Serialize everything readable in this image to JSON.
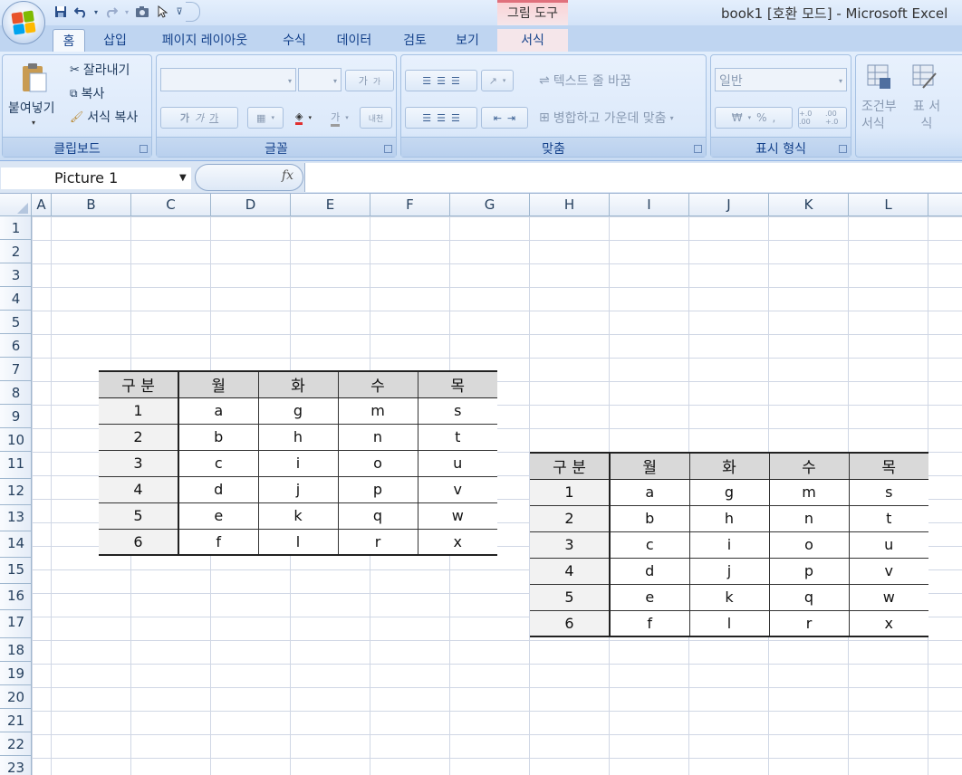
{
  "window": {
    "title": "book1  [호환 모드] - Microsoft Excel",
    "context_tab": "그림 도구"
  },
  "qat": {
    "icons": [
      "save-icon",
      "undo-icon",
      "redo-icon",
      "camera-icon",
      "pointer-icon",
      "customize-icon"
    ]
  },
  "tabs": [
    "홈",
    "삽입",
    "페이지 레이아웃",
    "수식",
    "데이터",
    "검토",
    "보기",
    "서식"
  ],
  "ribbon": {
    "clipboard": {
      "paste": "붙여넣기",
      "cut": "잘라내기",
      "copy": "복사",
      "format_painter": "서식 복사",
      "label": "클립보드"
    },
    "font": {
      "label": "글꼴",
      "grow": "가",
      "shrink": "가",
      "bold": "가",
      "italic": "가",
      "underline": "가",
      "font_color": "가",
      "phonetic": "내천"
    },
    "alignment": {
      "wrap": "텍스트 줄 바꿈",
      "merge": "병합하고 가운데 맞춤",
      "label": "맞춤"
    },
    "number": {
      "format": "일반",
      "currency": "₩",
      "percent": "%",
      "comma": ",",
      "inc_dec": "+.0 .00",
      "dec_dec": ".00 +.0",
      "label": "표시 형식"
    },
    "styles": {
      "conditional": "조건부 서식",
      "table": "표 서식"
    }
  },
  "formula_bar": {
    "name_box": "Picture 1",
    "fx": "fx",
    "value": ""
  },
  "columns": [
    "A",
    "B",
    "C",
    "D",
    "E",
    "F",
    "G",
    "H",
    "I",
    "J",
    "K",
    "L"
  ],
  "rows": [
    "1",
    "2",
    "3",
    "4",
    "5",
    "6",
    "7",
    "8",
    "9",
    "10",
    "11",
    "12",
    "13",
    "14",
    "15",
    "16",
    "17",
    "18",
    "19",
    "20",
    "21",
    "22",
    "23"
  ],
  "picture_table_1": {
    "headers": [
      "구 분",
      "월",
      "화",
      "수",
      "목"
    ],
    "rows": [
      [
        "1",
        "a",
        "g",
        "m",
        "s"
      ],
      [
        "2",
        "b",
        "h",
        "n",
        "t"
      ],
      [
        "3",
        "c",
        "i",
        "o",
        "u"
      ],
      [
        "4",
        "d",
        "j",
        "p",
        "v"
      ],
      [
        "5",
        "e",
        "k",
        "q",
        "w"
      ],
      [
        "6",
        "f",
        "l",
        "r",
        "x"
      ]
    ]
  },
  "picture_table_2": {
    "headers": [
      "구 분",
      "월",
      "화",
      "수",
      "목"
    ],
    "rows": [
      [
        "1",
        "a",
        "g",
        "m",
        "s"
      ],
      [
        "2",
        "b",
        "h",
        "n",
        "t"
      ],
      [
        "3",
        "c",
        "i",
        "o",
        "u"
      ],
      [
        "4",
        "d",
        "j",
        "p",
        "v"
      ],
      [
        "5",
        "e",
        "k",
        "q",
        "w"
      ],
      [
        "6",
        "f",
        "l",
        "r",
        "x"
      ]
    ]
  }
}
